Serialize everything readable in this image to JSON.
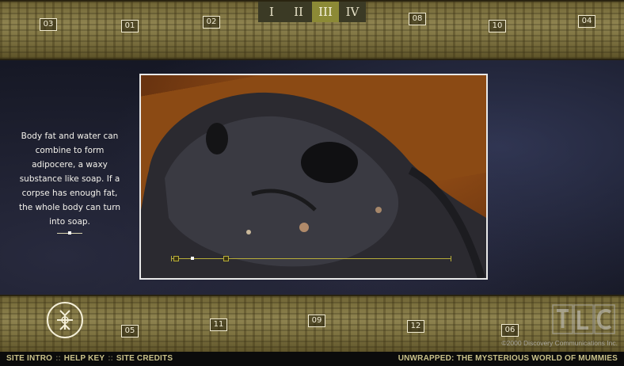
{
  "tabs": [
    {
      "label": "I",
      "active": false
    },
    {
      "label": "II",
      "active": false
    },
    {
      "label": "III",
      "active": true
    },
    {
      "label": "IV",
      "active": false
    }
  ],
  "top_numbers": [
    "03",
    "01",
    "02",
    "08",
    "10",
    "04"
  ],
  "bottom_numbers": [
    "05",
    "11",
    "09",
    "12",
    "06"
  ],
  "caption": "Body fat and water can combine to form adipocere, a waxy substance like soap. If a corpse has enough fat, the whole body can turn into soap.",
  "video": {
    "position_pct": 7
  },
  "branding": {
    "tlc_logo_text": "TLC"
  },
  "copyright": "©2000 Discovery Communications Inc.",
  "footer": {
    "site_intro": "SITE INTRO",
    "help_key": "HELP KEY",
    "site_credits": "SITE CREDITS",
    "separator": "::",
    "title": "UNWRAPPED: THE MYSTERIOUS WORLD OF MUMMIES"
  },
  "colors": {
    "accent": "#8c8a36",
    "scrubber": "#b8ad3a",
    "strip": "#8f8450"
  }
}
